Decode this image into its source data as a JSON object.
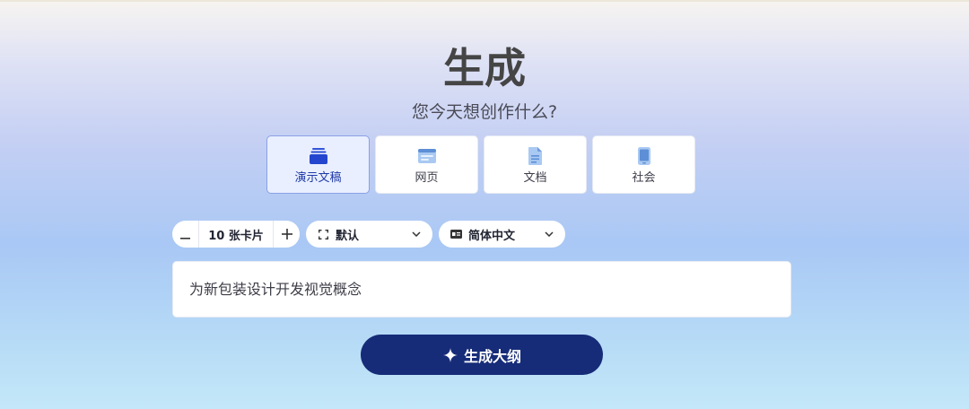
{
  "page": {
    "title": "生成",
    "subtitle": "您今天想创作什么?"
  },
  "mode_tabs": [
    {
      "label": "演示文稿",
      "icon": "presentation-stack-icon",
      "active": true
    },
    {
      "label": "网页",
      "icon": "webpage-icon",
      "active": false
    },
    {
      "label": "文档",
      "icon": "document-icon",
      "active": false
    },
    {
      "label": "社会",
      "icon": "social-phone-icon",
      "active": false
    }
  ],
  "controls": {
    "card_count": {
      "value": "10 张卡片",
      "minus_icon": "minus-icon",
      "plus_icon": "plus-icon"
    },
    "theme": {
      "value": "默认",
      "icon": "aspect-ratio-icon"
    },
    "language": {
      "value": "简体中文",
      "icon": "language-icon"
    }
  },
  "prompt": {
    "placeholder": "为新包装设计开发视觉概念"
  },
  "generate": {
    "label": "生成大纲",
    "icon": "sparkle-icon"
  },
  "colors": {
    "accent": "#162c78",
    "active_tab_bg": "#e9efff",
    "active_tab_text": "#1f3aa8"
  }
}
